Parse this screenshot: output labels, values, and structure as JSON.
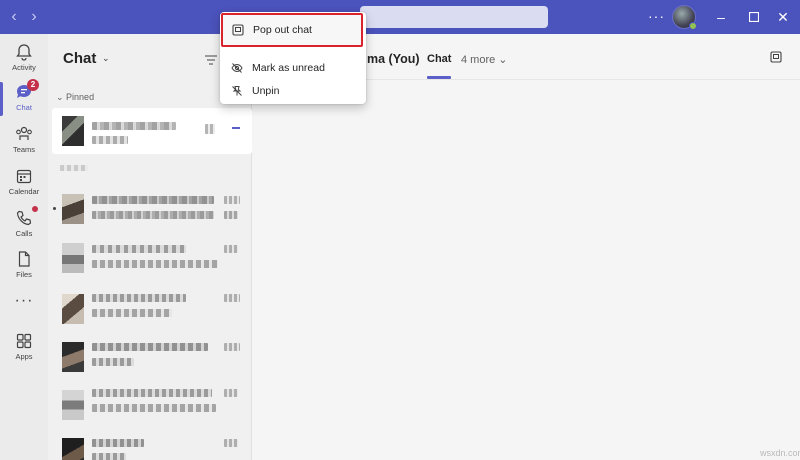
{
  "rail": {
    "items": [
      {
        "label": "Activity",
        "icon": "bell-icon"
      },
      {
        "label": "Chat",
        "icon": "chat-icon",
        "badge": "2",
        "active": true
      },
      {
        "label": "Teams",
        "icon": "teams-icon"
      },
      {
        "label": "Calendar",
        "icon": "calendar-icon"
      },
      {
        "label": "Calls",
        "icon": "phone-icon",
        "dot": true
      },
      {
        "label": "Files",
        "icon": "file-icon"
      }
    ],
    "more": "···",
    "apps_label": "Apps"
  },
  "titlebar": {
    "more": "···",
    "accent": "#4b53bc"
  },
  "chatlist": {
    "title": "Chat",
    "pinned_label": "Pinned"
  },
  "main": {
    "conversation_title": "ma (You)",
    "tab_chat": "Chat",
    "tab_more": "4 more"
  },
  "context_menu": {
    "items": [
      {
        "label": "Pop out chat",
        "icon": "popout-icon",
        "highlighted": true
      },
      {
        "label": "Mark as unread",
        "icon": "eye-off-icon"
      },
      {
        "label": "Unpin",
        "icon": "unpin-icon"
      }
    ]
  },
  "watermark": "wsxdn.com"
}
